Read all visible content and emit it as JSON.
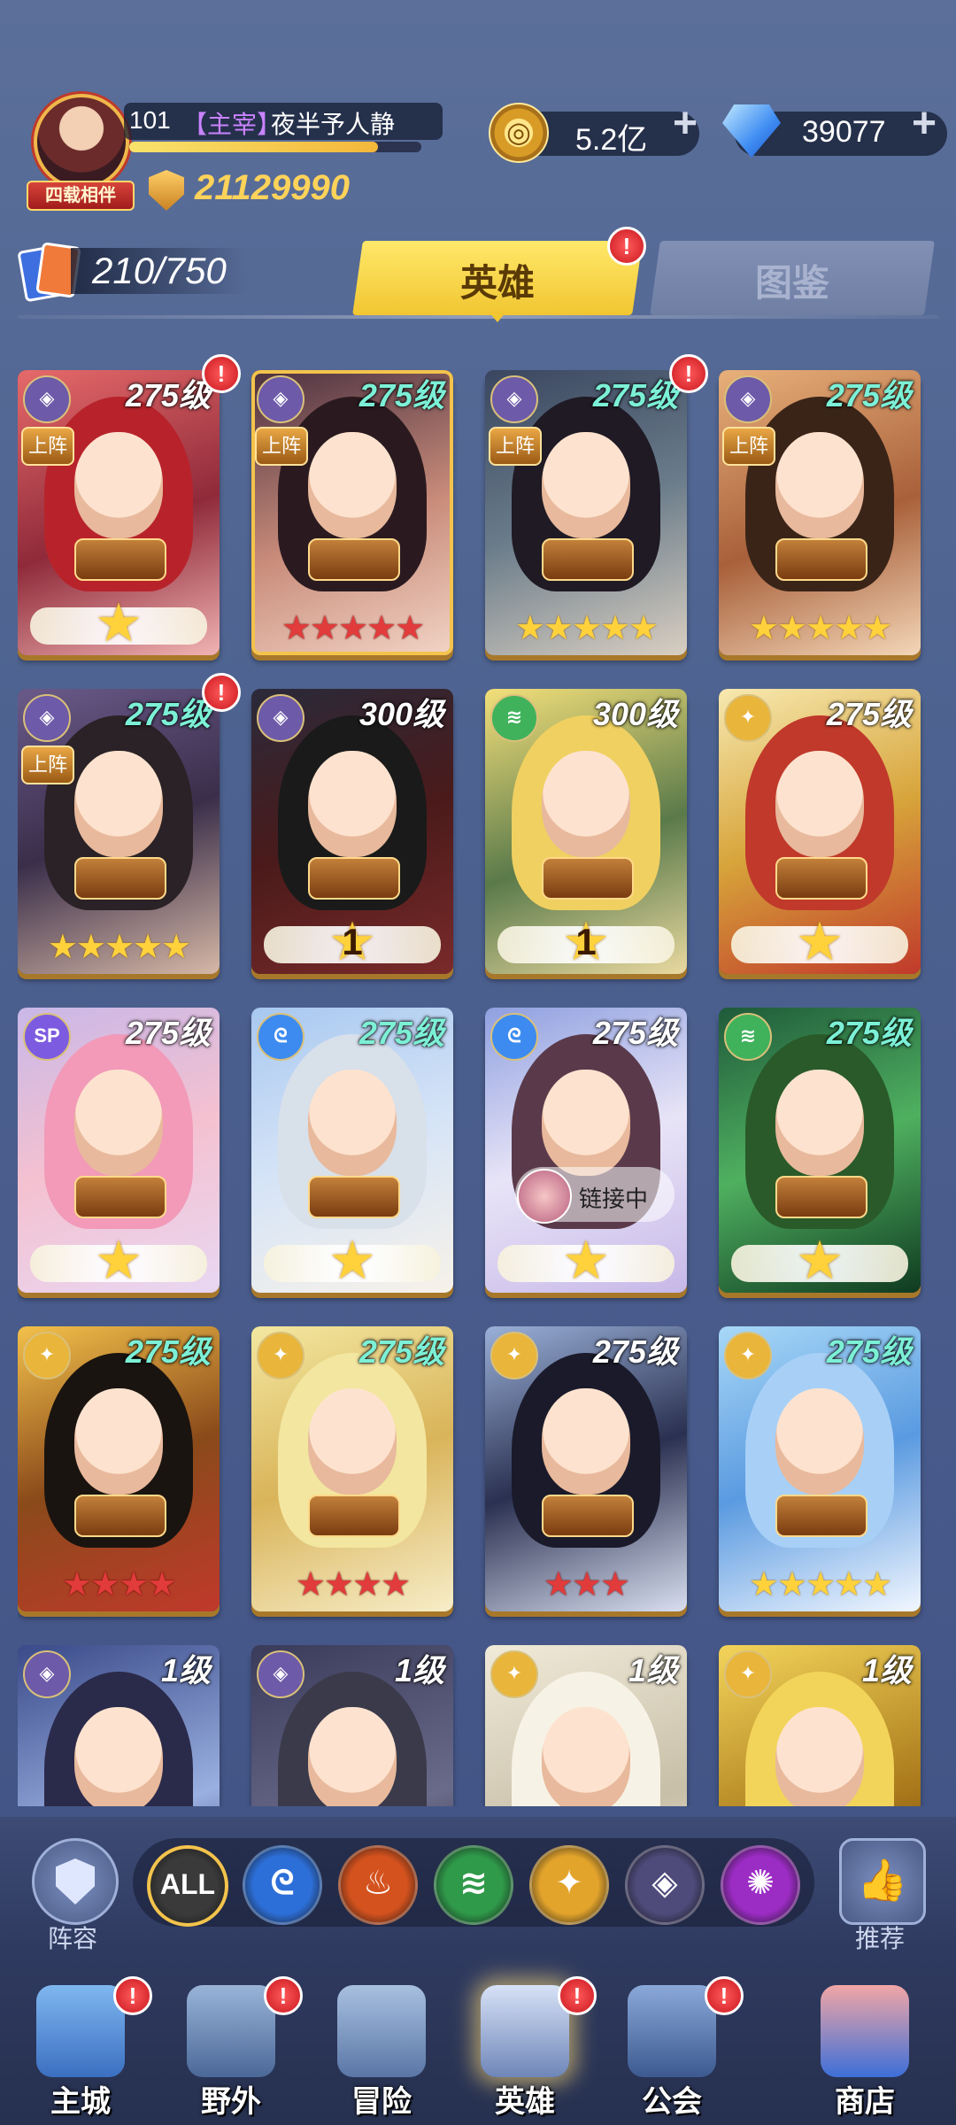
{
  "player": {
    "level": "101",
    "title": "【主宰】",
    "name": "夜半予人静",
    "badge": "四载相伴",
    "power": "21129990",
    "exp_fraction": 0.85
  },
  "currency": {
    "coins": "5.2亿",
    "gems": "39077",
    "plus": "+"
  },
  "hero_count": "210/750",
  "tabs": {
    "hero": "英雄",
    "book": "图鉴",
    "notify": "!"
  },
  "cards": [
    {
      "level": "275级",
      "faction": "void",
      "deploy": "上阵",
      "stars": 1,
      "star_type": "wing",
      "alert": true
    },
    {
      "level": "275级",
      "faction": "void",
      "deploy": "上阵",
      "stars": 5,
      "star_type": "red",
      "alert": false,
      "selected": true
    },
    {
      "level": "275级",
      "faction": "void",
      "deploy": "上阵",
      "stars": 5,
      "star_type": "gold",
      "alert": true
    },
    {
      "level": "275级",
      "faction": "void",
      "deploy": "上阵",
      "stars": 5,
      "star_type": "gold",
      "alert": false
    },
    {
      "level": "275级",
      "faction": "void",
      "deploy": "上阵",
      "stars": 5,
      "star_type": "gold",
      "alert": true
    },
    {
      "level": "300级",
      "faction": "void",
      "stars": 1,
      "star_type": "rank",
      "rank": "1",
      "alert": false
    },
    {
      "level": "300级",
      "faction": "forest",
      "stars": 1,
      "star_type": "rank",
      "rank": "1",
      "alert": false
    },
    {
      "level": "275级",
      "faction": "light",
      "stars": 1,
      "star_type": "wing",
      "alert": false
    },
    {
      "level": "275级",
      "faction": "sp",
      "stars": 1,
      "star_type": "wing",
      "alert": false
    },
    {
      "level": "275级",
      "faction": "water",
      "stars": 1,
      "star_type": "wing",
      "alert": false
    },
    {
      "level": "275级",
      "faction": "water",
      "stars": 1,
      "star_type": "wing",
      "alert": false,
      "link": "链接中"
    },
    {
      "level": "275级",
      "faction": "forest",
      "stars": 1,
      "star_type": "wing",
      "alert": false
    },
    {
      "level": "275级",
      "faction": "light",
      "stars": 4,
      "star_type": "red",
      "alert": false
    },
    {
      "level": "275级",
      "faction": "light",
      "stars": 4,
      "star_type": "red",
      "alert": false
    },
    {
      "level": "275级",
      "faction": "light",
      "stars": 3,
      "star_type": "red",
      "alert": false
    },
    {
      "level": "275级",
      "faction": "light",
      "stars": 5,
      "star_type": "gold",
      "alert": false
    },
    {
      "level": "1级",
      "faction": "void",
      "stars": 0,
      "alert": false
    },
    {
      "level": "1级",
      "faction": "void",
      "stars": 0,
      "alert": false
    },
    {
      "level": "1级",
      "faction": "light",
      "stars": 0,
      "alert": false
    },
    {
      "level": "1级",
      "faction": "light",
      "stars": 0,
      "alert": false
    }
  ],
  "filter": {
    "formation": "阵容",
    "recommend": "推荐",
    "all": "ALL",
    "factions": [
      "all",
      "water",
      "fire",
      "forest",
      "light",
      "void",
      "chaos"
    ]
  },
  "nav": [
    {
      "label": "主城",
      "icon": "castle-icon",
      "alert": true
    },
    {
      "label": "野外",
      "icon": "portal-icon",
      "alert": true
    },
    {
      "label": "冒险",
      "icon": "gate-icon",
      "alert": false
    },
    {
      "label": "英雄",
      "icon": "helmet-icon",
      "alert": true,
      "active": true
    },
    {
      "label": "公会",
      "icon": "banner-icon",
      "alert": true
    },
    {
      "label": "商店",
      "icon": "shop-icon",
      "alert": false
    }
  ],
  "colors": {
    "water": "#3d8bf0",
    "fire": "#e8632b",
    "forest": "#3fb25b",
    "light": "#e9b53a",
    "void": "#6d5aa8",
    "chaos": "#b23cd9",
    "sp": "#7d5be0"
  }
}
